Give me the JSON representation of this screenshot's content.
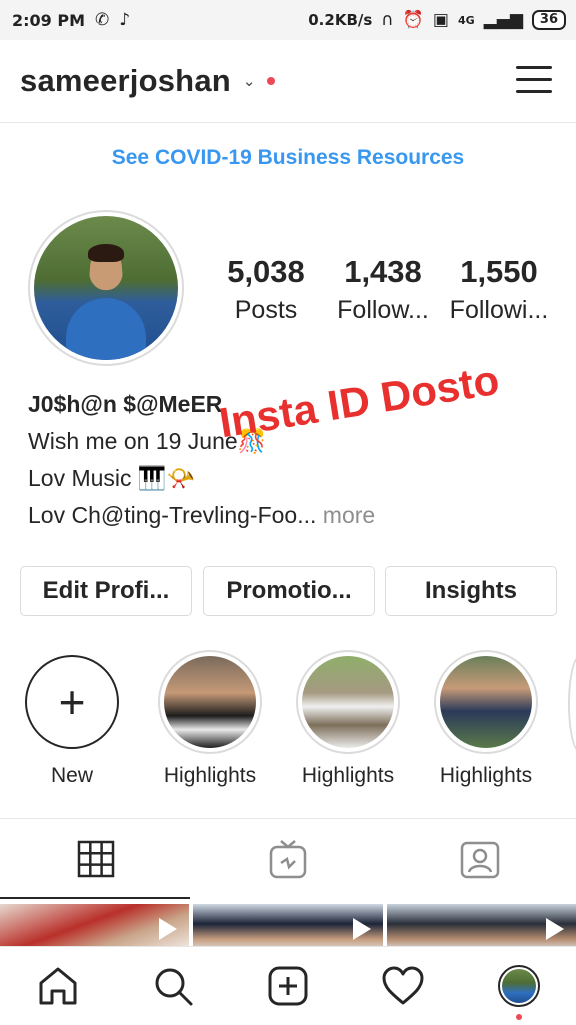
{
  "status_bar": {
    "time": "2:09 PM",
    "speed": "0.2KB/s",
    "network": "4G",
    "battery": "36"
  },
  "profile": {
    "username": "sameerjoshan",
    "covid_link": "See COVID-19 Business Resources",
    "stats": [
      {
        "value": "5,038",
        "label": "Posts"
      },
      {
        "value": "1,438",
        "label": "Follow..."
      },
      {
        "value": "1,550",
        "label": "Followi..."
      }
    ],
    "display_name": "J0$h@n $@MeER",
    "bio_lines": [
      "Wish me on 19 June🎊",
      "Lov Music 🎹📯",
      "Lov Ch@ting-Trevling-Foo..."
    ],
    "bio_more": "more",
    "watermark": "Insta ID Dosto"
  },
  "buttons": {
    "edit_profile": "Edit Profi...",
    "promotions": "Promotio...",
    "insights": "Insights"
  },
  "highlights": [
    {
      "label": "New"
    },
    {
      "label": "Highlights"
    },
    {
      "label": "Highlights"
    },
    {
      "label": "Highlights"
    }
  ],
  "colors": {
    "accent": "#3897f0",
    "watermark": "#e8312f",
    "notification": "#ed4956"
  },
  "icons": [
    "grid-icon",
    "igtv-icon",
    "tagged-icon",
    "home-icon",
    "search-icon",
    "add-post-icon",
    "heart-icon",
    "profile-avatar"
  ]
}
